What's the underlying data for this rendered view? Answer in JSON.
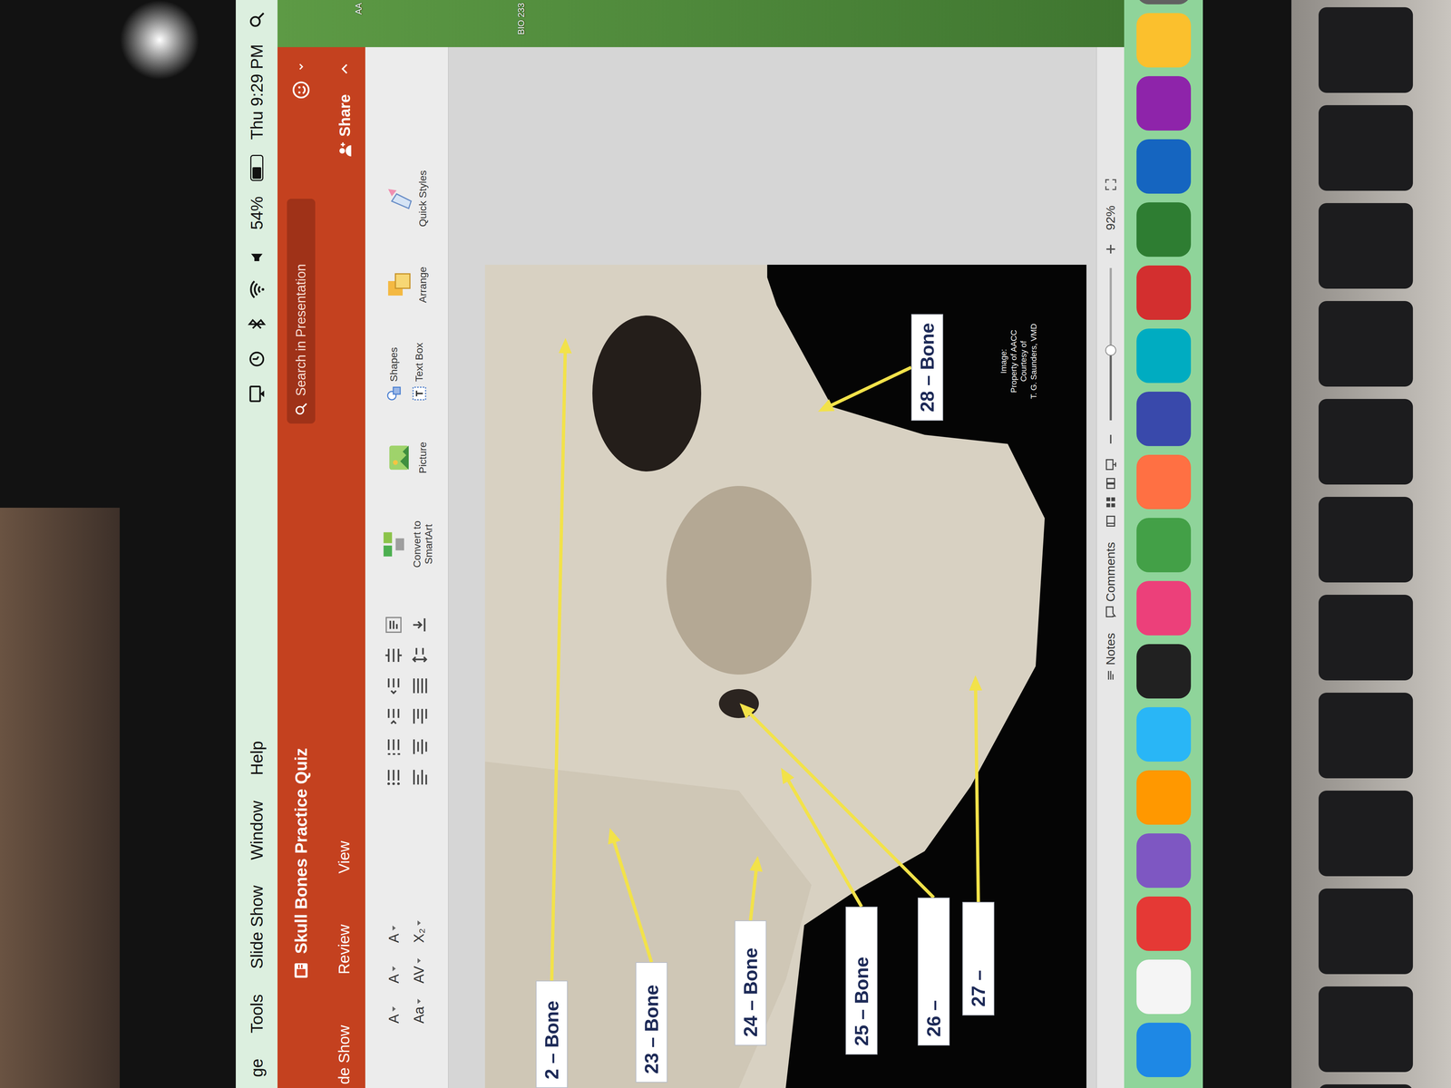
{
  "menu_bar": {
    "menus": [
      "ge",
      "Tools",
      "Slide Show",
      "Window",
      "Help"
    ],
    "battery": {
      "reading": "54%",
      "level": 0.54
    },
    "clock": "Thu 9:29 PM"
  },
  "desktop": {
    "icons": [
      "AA",
      "BIO 233"
    ]
  },
  "window": {
    "title": "Skull Bones Practice Quiz",
    "search": {
      "placeholder": "Search in Presentation"
    },
    "share": "Share"
  },
  "tabs": [
    {
      "label": "de Show",
      "selected": false
    },
    {
      "label": "Review",
      "selected": false
    },
    {
      "label": "View",
      "selected": false
    }
  ],
  "ribbon": {
    "font_buttons": [
      "A",
      "A",
      "A",
      "Aa",
      "AV",
      "X₂"
    ],
    "tools": [
      {
        "label": "Convert to SmartArt",
        "kind": "large"
      },
      {
        "label": "Picture",
        "kind": "large"
      },
      {
        "label": "Shapes",
        "kind": "small"
      },
      {
        "label": "Text Box",
        "kind": "small"
      },
      {
        "label": "Arrange",
        "kind": "large"
      },
      {
        "label": "Quick Styles",
        "kind": "large"
      }
    ]
  },
  "slide": {
    "labels": [
      "2 – Bone",
      "23 – Bone",
      "24 – Bone",
      "25 – Bone",
      "26 –",
      "27 –",
      "28 – Bone"
    ],
    "credit": [
      "Image:",
      "Property of AACC",
      "Courtesy of",
      "T. G. Saunders, VMD"
    ]
  },
  "status_bar": {
    "notes": "Notes",
    "comments": "Comments",
    "zoom": {
      "level": 0.46,
      "reading": "92%"
    }
  }
}
